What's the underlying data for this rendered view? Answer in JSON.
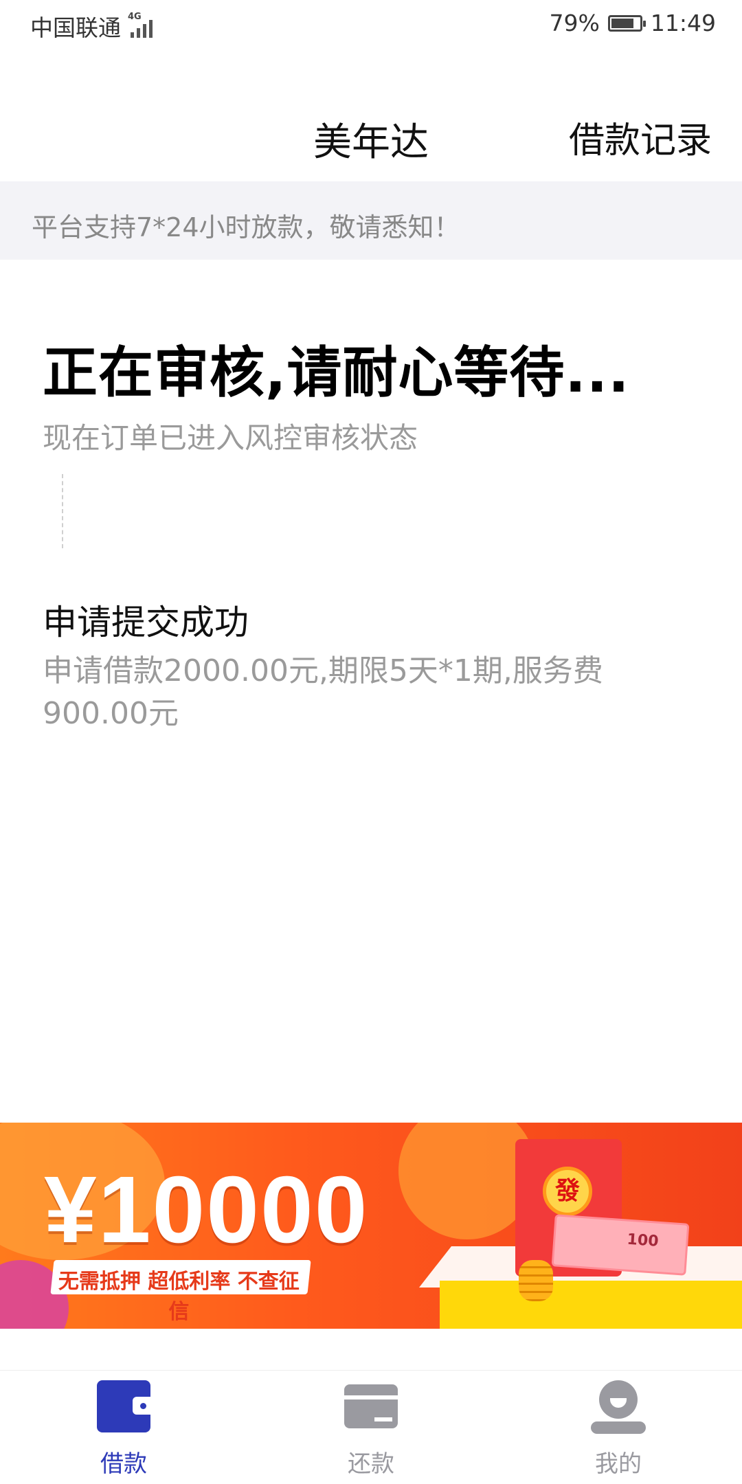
{
  "status_bar": {
    "carrier": "中国联通",
    "network": "4G",
    "battery_percent": "79%",
    "battery_level": 0.79,
    "time": "11:49"
  },
  "header": {
    "title": "美年达",
    "records_link": "借款记录"
  },
  "notice": {
    "text": "平台支持7*24小时放款，敬请悉知！"
  },
  "review": {
    "heading": "正在审核,请耐心等待...",
    "subtext": "现在订单已进入风控审核状态"
  },
  "step": {
    "title": "申请提交成功",
    "description": "申请借款2000.00元,期限5天*1期,服务费900.00元"
  },
  "banner": {
    "amount": "¥10000",
    "slogan": "无需抵押  超低利率  不查征信",
    "seal_char": "發",
    "cash_note": "100",
    "colors": {
      "primary": "#ff5a1c",
      "accent": "#ffd80a"
    }
  },
  "bottom_nav": {
    "items": [
      {
        "label": "借款",
        "icon": "wallet-icon",
        "active": true
      },
      {
        "label": "还款",
        "icon": "card-icon",
        "active": false
      },
      {
        "label": "我的",
        "icon": "person-icon",
        "active": false
      }
    ],
    "active_color": "#2d3ab8",
    "inactive_color": "#9a9aa0"
  }
}
